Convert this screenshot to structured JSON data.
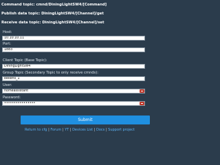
{
  "topics": {
    "command_label": "Command topic:",
    "command_value": "cmnd/DiningLightSW4/[Command]",
    "publish_label": "Publish data topic:",
    "publish_value": "DiningLightSW4/[Channel]/get",
    "receive_label": "Receive data topic:",
    "receive_value": "DiningLightSW4/[Channel]/set"
  },
  "form": {
    "host_label": "Host:",
    "host_value": "10.10.10.11",
    "port_label": "Port:",
    "port_value": "1883",
    "client_topic_label": "Client Topic (Base Topic):",
    "client_topic_value": "DiningLightSW4",
    "group_topic_label": "Group Topic (Secondary Topic to only receive cmnds):",
    "group_topic_value": "bekens_1",
    "user_label": "User:",
    "user_value": "homeassistant",
    "password_label": "Password:",
    "password_value": "••••••••••••••••"
  },
  "submit_label": "Submit",
  "footer": {
    "return": "Return to cfg",
    "forum": "Forum",
    "yt": "YT",
    "devices": "Devices List",
    "docs": "Docs",
    "support": "Support project"
  }
}
